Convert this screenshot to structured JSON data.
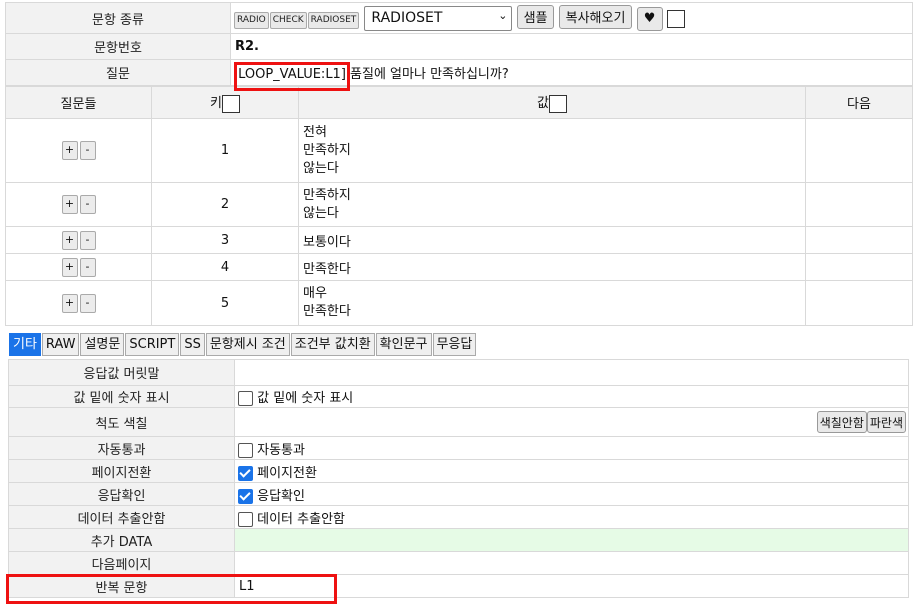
{
  "header": {
    "type_label": "문항 종류",
    "type_buttons": [
      "RADIO",
      "CHECK",
      "RADIOSET"
    ],
    "type_select": "RADIOSET",
    "sample_btn": "샘플",
    "copy_btn": "복사해오기",
    "heart_btn": "♥",
    "id_label": "문항번호",
    "id_value": "R2.",
    "question_label": "질문",
    "question_loop": "[LOOP_VALUE:L1]",
    "question_text": " 품질에 얼마나 만족하십니까?"
  },
  "grid": {
    "col_questions": "질문들",
    "col_key": "키",
    "col_value": "값",
    "col_next": "다음",
    "rows": [
      {
        "key": "1",
        "value_lines": [
          "전혀",
          "만족하지",
          "않는다"
        ]
      },
      {
        "key": "2",
        "value_lines": [
          "만족하지",
          "않는다"
        ]
      },
      {
        "key": "3",
        "value_lines": [
          "보통이다"
        ]
      },
      {
        "key": "4",
        "value_lines": [
          "만족한다"
        ]
      },
      {
        "key": "5",
        "value_lines": [
          "매우",
          "만족한다"
        ]
      }
    ],
    "plus": "+",
    "minus": "-"
  },
  "tabs": [
    "기타",
    "RAW",
    "설명문",
    "SCRIPT",
    "SS",
    "문항제시 조건",
    "조건부 값치환",
    "확인문구",
    "무응답"
  ],
  "props": {
    "header_label": "응답값 머릿말",
    "num_label": "값 밑에 숫자 표시",
    "num_check": "값 밑에 숫자 표시",
    "color_label": "척도 색칠",
    "color_btn1": "색칠안함",
    "color_btn2": "파란색",
    "auto_label": "자동통과",
    "auto_check": "자동통과",
    "page_label": "페이지전환",
    "page_check": "페이지전환",
    "confirm_label": "응답확인",
    "confirm_check": "응답확인",
    "extract_label": "데이터 추출안함",
    "extract_check": "데이터 추출안함",
    "extra_label": "추가 DATA",
    "nextpage_label": "다음페이지",
    "repeat_label": "반복 문항",
    "repeat_value": "L1"
  }
}
